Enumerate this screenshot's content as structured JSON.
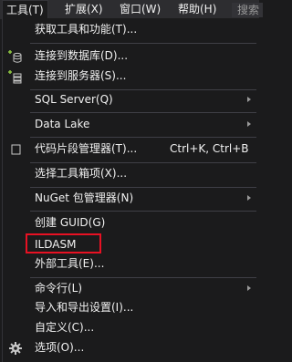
{
  "menubar": {
    "items": [
      {
        "label": "工具(T)"
      },
      {
        "label": "扩展(X)"
      },
      {
        "label": "窗口(W)"
      },
      {
        "label": "帮助(H)"
      }
    ],
    "search_placeholder": "搜索"
  },
  "menu": {
    "items": [
      {
        "label": "获取工具和功能(T)..."
      },
      {
        "label": "连接到数据库(D)..."
      },
      {
        "label": "连接到服务器(S)..."
      },
      {
        "label": "SQL Server(Q)"
      },
      {
        "label": "Data Lake"
      },
      {
        "label": "代码片段管理器(T)...",
        "shortcut": "Ctrl+K, Ctrl+B"
      },
      {
        "label": "选择工具箱项(X)..."
      },
      {
        "label": "NuGet 包管理器(N)"
      },
      {
        "label": "创建 GUID(G)"
      },
      {
        "label": "ILDASM"
      },
      {
        "label": "外部工具(E)..."
      },
      {
        "label": "命令行(L)"
      },
      {
        "label": "导入和导出设置(I)..."
      },
      {
        "label": "自定义(C)..."
      },
      {
        "label": "选项(O)..."
      }
    ]
  },
  "colors": {
    "background": "#1b1b1c",
    "menubar": "#2d2d30",
    "text": "#f1f1f1",
    "highlight_border": "#e81123"
  }
}
